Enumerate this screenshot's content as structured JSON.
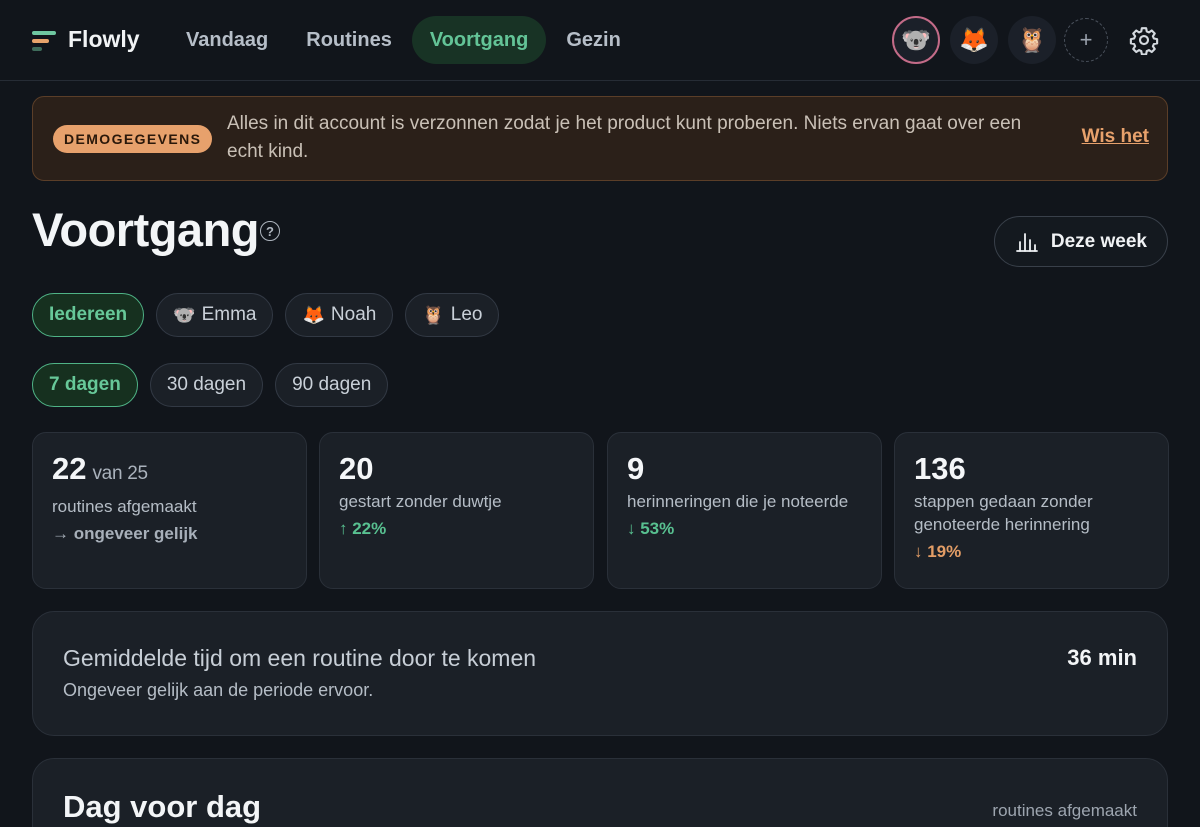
{
  "app": {
    "name": "Flowly"
  },
  "nav": {
    "items": [
      {
        "label": "Vandaag",
        "active": false
      },
      {
        "label": "Routines",
        "active": false
      },
      {
        "label": "Voortgang",
        "active": true
      },
      {
        "label": "Gezin",
        "active": false
      }
    ]
  },
  "profiles": [
    {
      "emoji": "🐨",
      "icon": "koala-avatar",
      "selected": true
    },
    {
      "emoji": "🦊",
      "icon": "fox-avatar",
      "selected": false
    },
    {
      "emoji": "🦉",
      "icon": "owl-avatar",
      "selected": false
    }
  ],
  "add_profile_symbol": "+",
  "banner": {
    "badge": "DEMOGEGEVENS",
    "text": "Alles in dit account is verzonnen zodat je het product kunt proberen. Niets ervan gaat over een echt kind.",
    "action": "Wis het"
  },
  "page": {
    "title": "Voortgang",
    "help_symbol": "?",
    "range_button": "Deze week"
  },
  "people_filter": [
    {
      "label": "Iedereen",
      "emoji": "",
      "active": true
    },
    {
      "label": "Emma",
      "emoji": "🐨",
      "active": false
    },
    {
      "label": "Noah",
      "emoji": "🦊",
      "active": false
    },
    {
      "label": "Leo",
      "emoji": "🦉",
      "active": false
    }
  ],
  "period_filter": [
    {
      "label": "7 dagen",
      "active": true
    },
    {
      "label": "30 dagen",
      "active": false
    },
    {
      "label": "90 dagen",
      "active": false
    }
  ],
  "stats": [
    {
      "value": "22",
      "of": "van 25",
      "label": "routines afgemaakt",
      "trend": "→ ongeveer gelijk",
      "trend_type": "neutral"
    },
    {
      "value": "20",
      "of": "",
      "label": "gestart zonder duwtje",
      "trend": "↑ 22%",
      "trend_type": "up"
    },
    {
      "value": "9",
      "of": "",
      "label": "herinneringen die je noteerde",
      "trend": "↓ 53%",
      "trend_type": "up"
    },
    {
      "value": "136",
      "of": "",
      "label": "stappen gedaan zonder genoteerde herinnering",
      "trend": "↓ 19%",
      "trend_type": "warn"
    }
  ],
  "avg_time": {
    "title": "Gemiddelde tijd om een routine door te komen",
    "value": "36 min",
    "subtitle": "Ongeveer gelijk aan de periode ervoor."
  },
  "day_by_day": {
    "title": "Dag voor dag",
    "legend": "routines afgemaakt"
  },
  "colors": {
    "background": "#11151b",
    "accent_green": "#63c497",
    "accent_orange": "#e7a16c",
    "card": "#1b2027"
  }
}
